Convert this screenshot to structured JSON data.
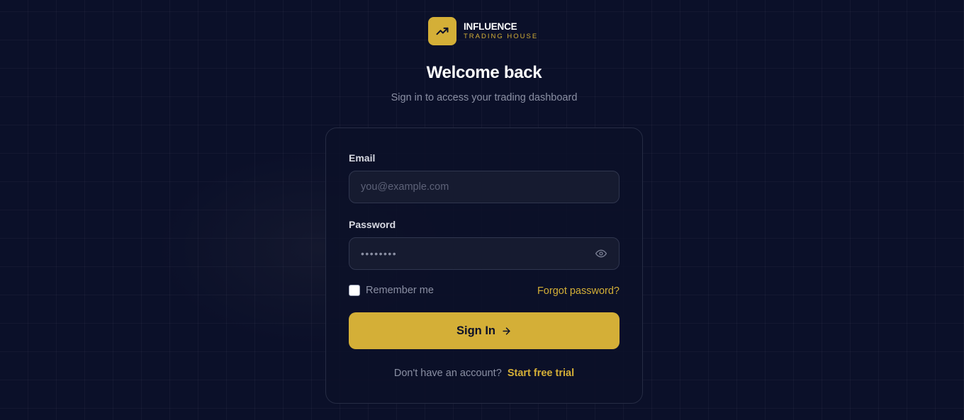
{
  "brand": {
    "name": "INFLUENCE",
    "tagline": "TRADING HOUSE",
    "icon": "trending-up-icon",
    "accent_color": "#d4af37"
  },
  "header": {
    "title": "Welcome back",
    "subtitle": "Sign in to access your trading dashboard"
  },
  "form": {
    "email": {
      "label": "Email",
      "placeholder": "you@example.com",
      "value": ""
    },
    "password": {
      "label": "Password",
      "masked_value": "••••••••",
      "toggle_icon": "eye-icon"
    },
    "remember": {
      "label": "Remember me",
      "checked": false
    },
    "forgot_label": "Forgot password?",
    "submit_label": "Sign In",
    "submit_icon": "arrow-right-icon"
  },
  "footer": {
    "prompt": "Don't have an account?",
    "link_label": "Start free trial"
  },
  "colors": {
    "background": "#0b1029",
    "card_border": "#262c44",
    "input_background": "#161b30",
    "muted_text": "#8a8fa3"
  }
}
